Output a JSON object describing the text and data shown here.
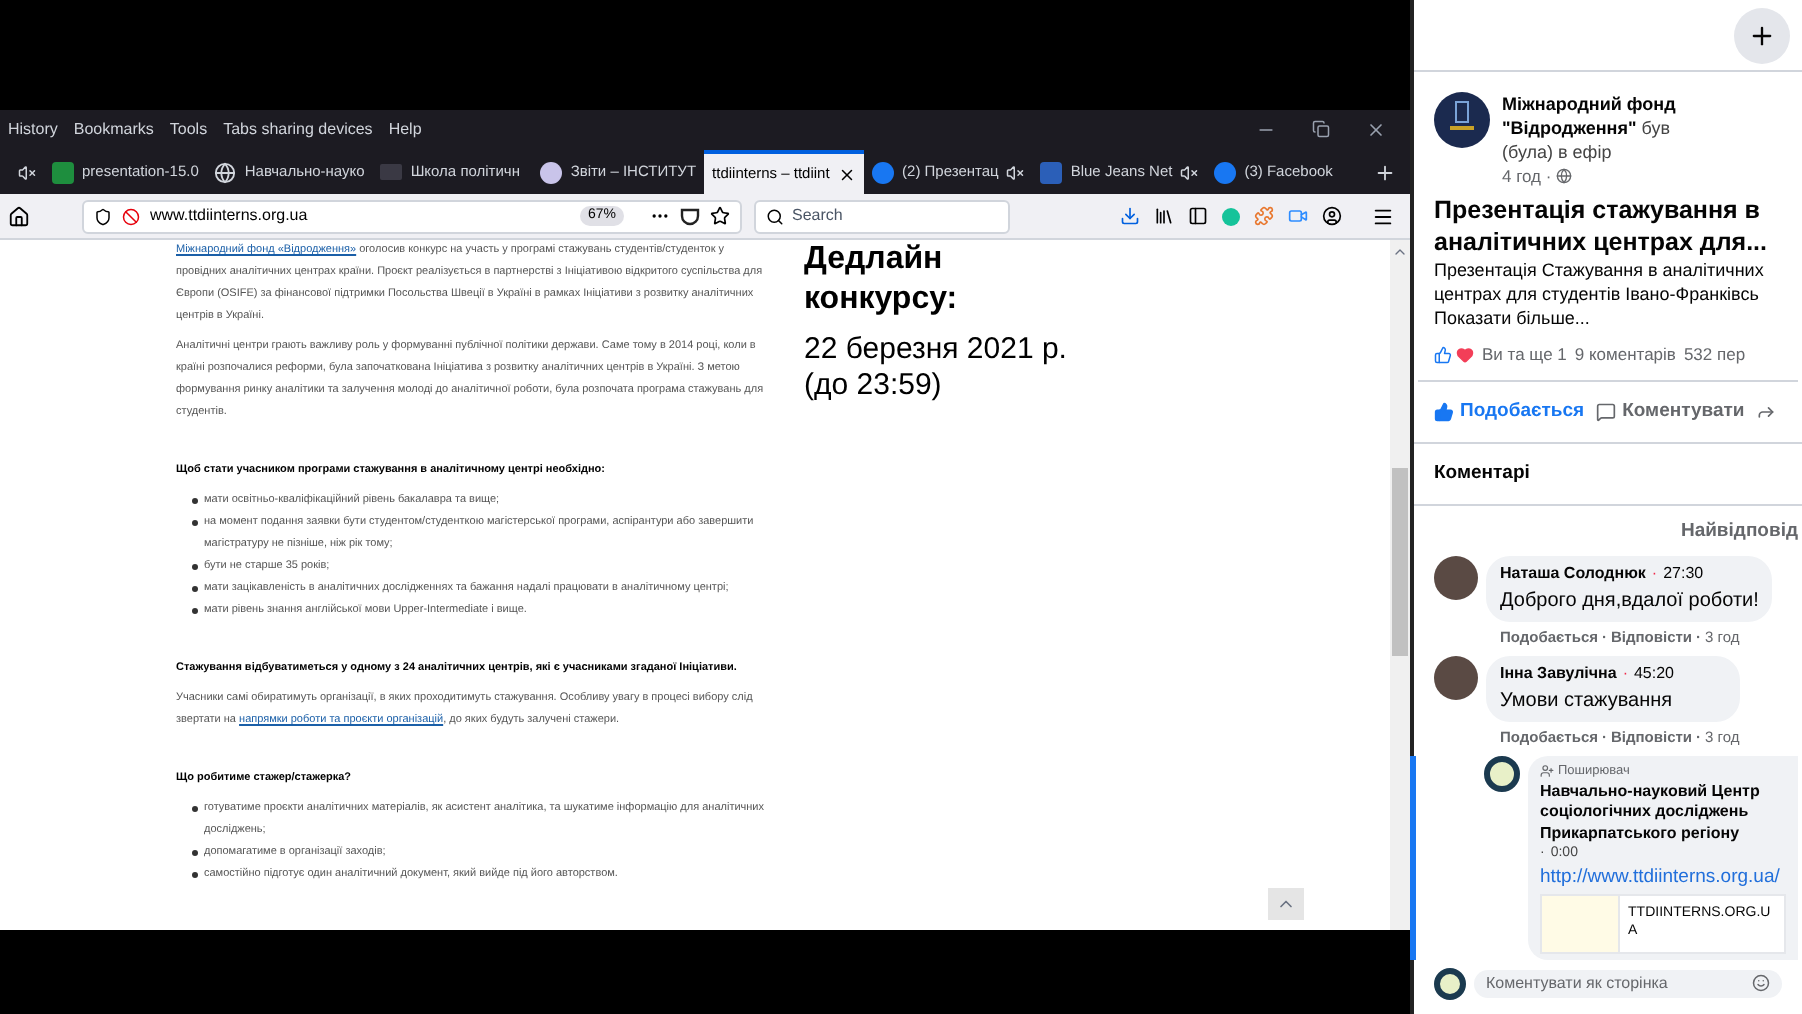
{
  "browser": {
    "menu": [
      "History",
      "Bookmarks",
      "Tools",
      "Tabs sharing devices",
      "Help"
    ],
    "tabs": [
      {
        "kind": "none",
        "muted": true,
        "selected": false
      },
      {
        "label": "presentation-15.0",
        "kind": "sheet",
        "muted": false,
        "selected": false
      },
      {
        "label": "Навчально-науко",
        "kind": "globe",
        "muted": false,
        "selected": false
      },
      {
        "label": "Школа політичн",
        "kind": "blank",
        "muted": false,
        "selected": false
      },
      {
        "label": "Звіти – ІНСТИТУТ",
        "kind": "chat",
        "muted": false,
        "selected": false
      },
      {
        "label": "ttdiinterns – ttdiint",
        "kind": "none",
        "muted": false,
        "selected": true
      },
      {
        "label": "(2) Презентац",
        "kind": "facebook",
        "muted": true,
        "selected": false
      },
      {
        "label": "Blue Jeans Net",
        "kind": "bluejeans",
        "muted": true,
        "selected": false
      },
      {
        "label": "(3) Facebook",
        "kind": "facebook",
        "muted": false,
        "selected": false
      }
    ],
    "url": "www.ttdiinterns.org.ua",
    "zoom": "67%",
    "search_placeholder": "Search"
  },
  "page": {
    "blocks": [
      {
        "kind": "paragraph",
        "parts": [
          {
            "text": "Міжнародний фонд «Відродження»",
            "link": true
          },
          {
            "text": " оголосив конкурс на участь у програмі стажувань студентів/студенток у провідних аналітичних центрах країни. Проєкт реалізується в партнерстві з Ініціативою відкритого суспільства для Європи (OSIFE) за фінансової підтримки Посольства Швеції в Україні в рамках Ініціативи з розвитку аналітичних центрів в Україні.",
            "link": false
          }
        ]
      },
      {
        "kind": "paragraph",
        "parts": [
          {
            "text": "Аналітичні центри грають важливу роль у формуванні публічної політики держави. Саме тому в 2014 році, коли в країні розпочалися реформи, була започаткована Ініціатива з розвитку аналітичних центрів в Україні. З метою формування ринку аналітики та залучення молоді до аналітичної роботи, була розпочата програма стажувань для студентів.",
            "link": false
          }
        ]
      },
      {
        "kind": "heading",
        "text": "Щоб стати учасником програми стажування в аналітичному центрі необхідно:"
      },
      {
        "kind": "list",
        "items": [
          "мати освітньо-кваліфікаційний рівень бакалавра та вище;",
          "на момент подання заявки бути студентом/студенткою магістерської програми, аспірантури або завершити магістратуру не пізніше, ніж рік тому;",
          "бути не старше 35 років;",
          "мати зацікавленість в аналітичних дослідженнях та бажання надалі працювати в аналітичному центрі;",
          "мати рівень знання англійської мови Upper-Intermediate і вище."
        ]
      },
      {
        "kind": "heading",
        "text": "Стажування відбуватиметься у одному з 24 аналітичних центрів, які є учасниками згаданої Ініціативи."
      },
      {
        "kind": "paragraph",
        "parts": [
          {
            "text": "Учасники самі обиратимуть організації, в яких проходитимуть стажування. Особливу увагу в процесі вибору слід звертати на ",
            "link": false
          },
          {
            "text": "напрямки роботи та проєкти організацій",
            "link": true
          },
          {
            "text": ", до яких будуть залучені стажери.",
            "link": false
          }
        ]
      },
      {
        "kind": "heading",
        "text": "Що робитиме стажер/стажерка?"
      },
      {
        "kind": "list",
        "items": [
          "готуватиме проєкти аналітичних матеріалів, як асистент аналітика, та шукатиме інформацію для аналітичних досліджень;",
          "допомагатиме в організації заходів;",
          "самостійно підготує один аналітичний документ, який вийде під його авторством."
        ]
      }
    ],
    "deadline": {
      "title": "Дедлайн конкурсу:",
      "date": "22 березня 2021 р.",
      "time": "(до 23:59)"
    }
  },
  "facebook": {
    "separator": "·",
    "post": {
      "author": "Міжнародний фонд \"Відродження\"",
      "status": "був (була) в ефір",
      "time": "4 год ·",
      "title": "Презентація стажування в аналітичних центрах для...",
      "description": [
        "Презентація Стажування в аналітичних",
        "центрах для студентів Івано-Франківсь"
      ],
      "more": "Показати більше...",
      "reactions": "Ви та ще 1",
      "comments_count": "9 коментарів",
      "views": "532 пер",
      "like": "Подобається",
      "comment": "Коментувати"
    },
    "comments_title": "Коментарі",
    "sort": "Найвідповід",
    "comments": [
      {
        "author": "Наташа Солоднюк",
        "time": "27:30",
        "text": "Доброго дня,вдалої роботи!",
        "actions": [
          "Подобається",
          "Відповісти",
          "3 год"
        ]
      },
      {
        "author": "Інна Завулічна",
        "time": "45:20",
        "text": "Умови стажування",
        "actions": [
          "Подобається",
          "Відповісти",
          "3 год"
        ]
      }
    ],
    "reply": {
      "badge": "Поширювач",
      "author": "Навчально-науковий Центр соціологічних досліджень Прикарпатського регіону",
      "time": "0:00",
      "link": "http://www.ttdiinterns.org.ua/",
      "preview": "TTDIINTERNS.ORG.UA"
    },
    "input_placeholder": "Коментувати як сторінка"
  }
}
